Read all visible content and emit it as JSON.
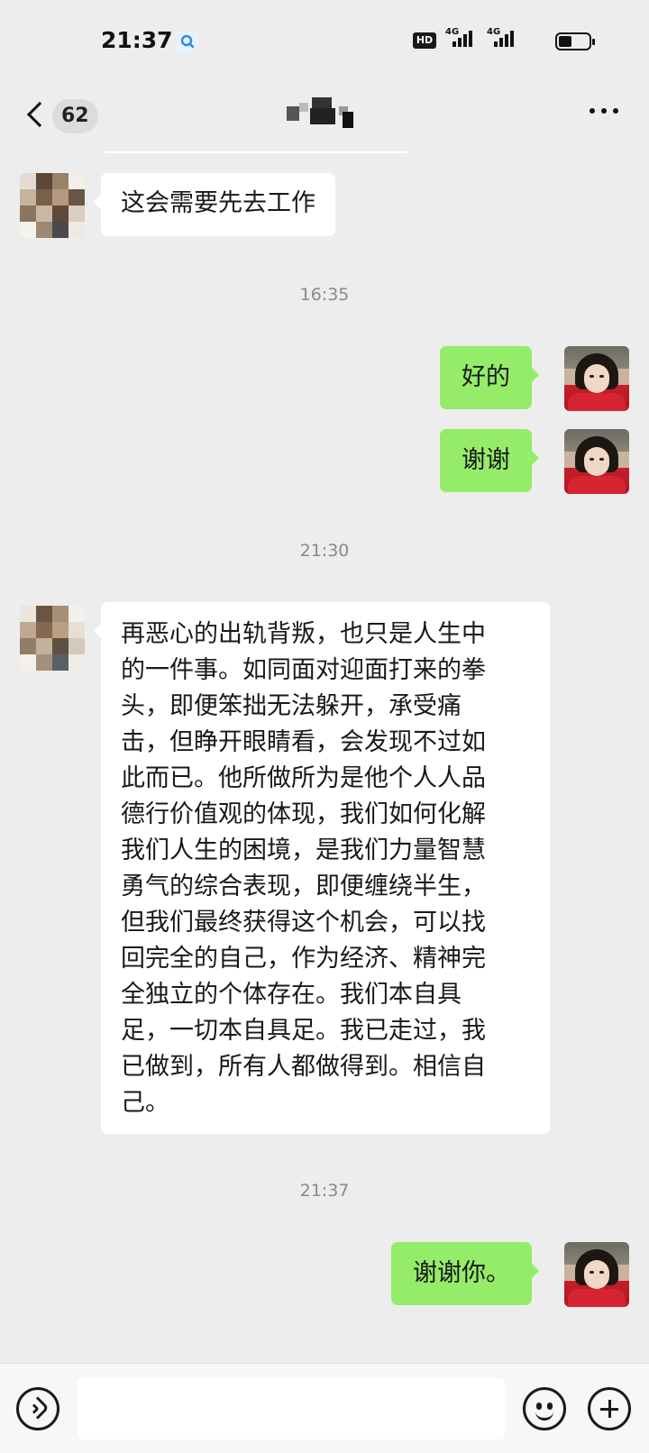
{
  "status_bar": {
    "time": "21:37",
    "hd_label": "HD",
    "network_1": "4G",
    "network_2": "4G"
  },
  "header": {
    "unread_count": "62"
  },
  "messages": [
    {
      "type": "text",
      "side": "left",
      "text": "这会需要先去工作"
    },
    {
      "type": "time",
      "text": "16:35"
    },
    {
      "type": "text",
      "side": "right",
      "text": "好的"
    },
    {
      "type": "text",
      "side": "right",
      "text": "谢谢"
    },
    {
      "type": "time",
      "text": "21:30"
    },
    {
      "type": "text",
      "side": "left",
      "lines": [
        "再恶心的出轨背叛，也只是人生中",
        "的一件事。如同面对迎面打来的拳",
        "头，即便笨拙无法躲开，承受痛",
        "击，但睁开眼睛看，会发现不过如",
        "此而已。他所做所为是他个人人品",
        "德行价值观的体现，我们如何化解",
        "我们人生的困境，是我们力量智慧",
        "勇气的综合表现，即便缠绕半生，",
        "但我们最终获得这个机会，可以找",
        "回完全的自己，作为经济、精神完",
        "全独立的个体存在。我们本自具",
        "足，一切本自具足。我已走过，我",
        "已做到，所有人都做得到。相信自",
        "己。"
      ]
    },
    {
      "type": "time",
      "text": "21:37"
    },
    {
      "type": "text",
      "side": "right",
      "text": "谢谢你。"
    }
  ],
  "input_bar": {
    "input_value": ""
  },
  "colors": {
    "background": "#ededed",
    "incoming_bubble": "#ffffff",
    "outgoing_bubble": "#95ec69",
    "timestamp": "#8a8a8a"
  },
  "icons": {
    "voice": "voice-icon",
    "emoji": "emoji-icon",
    "plus": "plus-icon",
    "back": "chevron-left-icon",
    "more": "more-dots-icon"
  }
}
